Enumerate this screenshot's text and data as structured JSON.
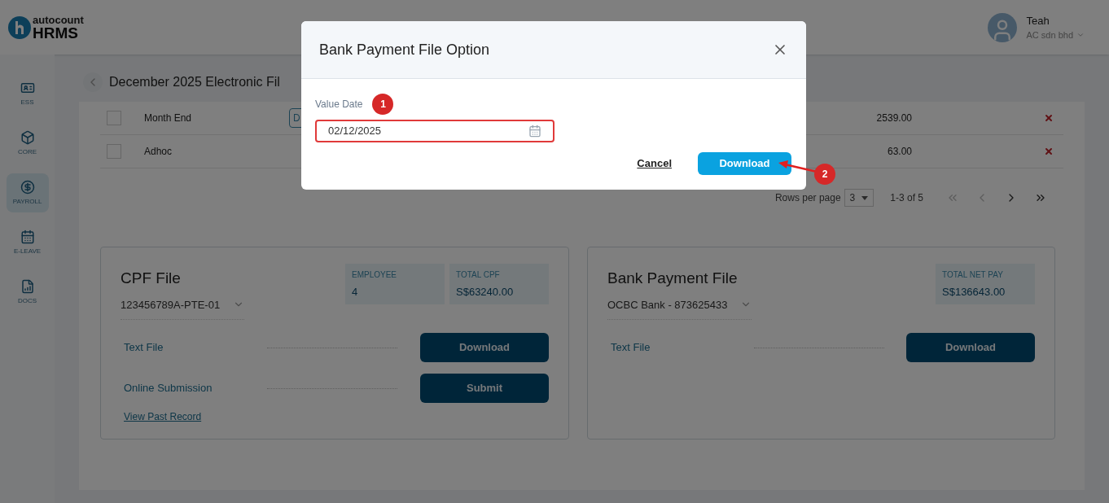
{
  "header": {
    "logo_top": "autocount",
    "logo_bottom": "HRMS",
    "user_name": "Teah",
    "company": "AC sdn bhd"
  },
  "sidebar": {
    "items": [
      {
        "label": "ESS",
        "kind": "ess",
        "selected": false
      },
      {
        "label": "CORE",
        "kind": "core",
        "selected": false
      },
      {
        "label": "PAYROLL",
        "kind": "payroll",
        "selected": true
      },
      {
        "label": "E-LEAVE",
        "kind": "leave",
        "selected": false
      },
      {
        "label": "DOCS",
        "kind": "docs",
        "selected": false
      }
    ]
  },
  "page": {
    "title": "December 2025 Electronic Fil"
  },
  "table": {
    "rows": [
      {
        "name": "Month End",
        "button": "D",
        "amount": "2539.00",
        "checked": false
      },
      {
        "name": "Adhoc",
        "amount": "63.00",
        "checked": false
      }
    ],
    "pagination": {
      "rows_label": "Rows per page",
      "rows_value": "3",
      "range": "1-3 of 5"
    }
  },
  "cpf_card": {
    "title": "CPF File",
    "account": "123456789A-PTE-01",
    "stats": [
      {
        "label": "EMPLOYEE",
        "value": "4"
      },
      {
        "label": "TOTAL CPF",
        "value": "S$63240.00"
      }
    ],
    "actions": [
      {
        "label": "Text File",
        "button": "Download"
      },
      {
        "label": "Online Submission",
        "button": "Submit"
      }
    ],
    "link": "View Past Record"
  },
  "bank_card": {
    "title": "Bank Payment File",
    "account": "OCBC Bank - 873625433",
    "stats": [
      {
        "label": "TOTAL NET PAY",
        "value": "S$136643.00"
      }
    ],
    "actions": [
      {
        "label": "Text File",
        "button": "Download"
      }
    ]
  },
  "dialog": {
    "title": "Bank Payment File Option",
    "field_label": "Value Date",
    "field_value": "02/12/2025",
    "cancel": "Cancel",
    "confirm": "Download"
  },
  "annotations": [
    {
      "number": "1"
    },
    {
      "number": "2"
    }
  ]
}
